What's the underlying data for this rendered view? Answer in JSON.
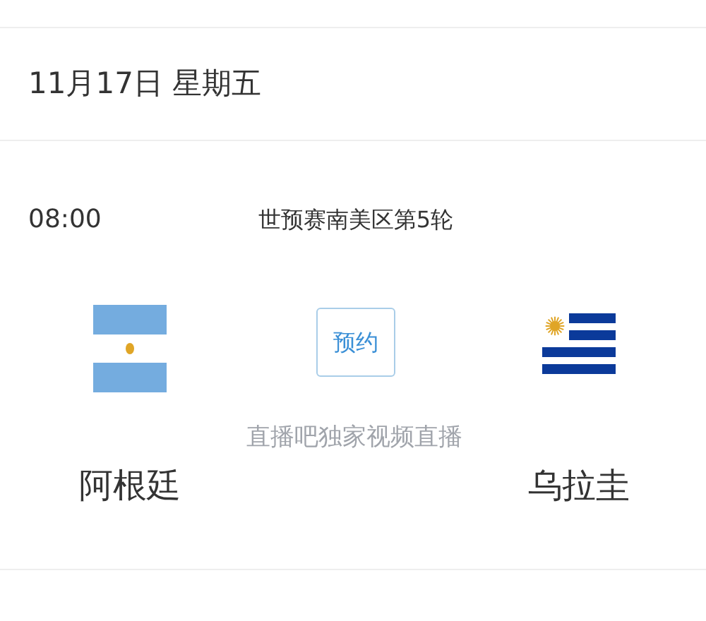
{
  "date": "11月17日 星期五",
  "match": {
    "time": "08:00",
    "league": "世预赛南美区第5轮",
    "home": {
      "name": "阿根廷",
      "kind": "argentina"
    },
    "away": {
      "name": "乌拉圭",
      "kind": "uruguay"
    },
    "action": {
      "label": "预约"
    },
    "broadcast": "直播吧独家视频直播"
  }
}
